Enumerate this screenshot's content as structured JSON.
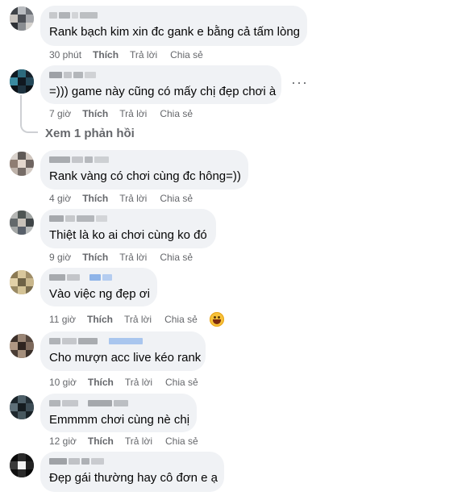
{
  "labels": {
    "like": "Thích",
    "reply": "Trả lời",
    "share": "Chia sẻ"
  },
  "comments": [
    {
      "text": "Rank bạch kim xin đc gank e bằng cả tấm lòng",
      "time": "30 phút"
    },
    {
      "text": "=))) game này cũng có mấy chị đẹp chơi à",
      "time": "7 giờ",
      "view_replies": "Xem 1 phản hồi"
    },
    {
      "text": "Rank vàng có chơi cùng đc hông=))",
      "time": "4 giờ"
    },
    {
      "text": "Thiệt là ko ai chơi cùng ko đó",
      "time": "9 giờ"
    },
    {
      "text": "Vào việc ng đẹp ơi",
      "time": "11 giờ",
      "reaction": "grinning-sweat-emoji"
    },
    {
      "text": "Cho mượn acc live kéo rank",
      "time": "10 giờ"
    },
    {
      "text": "Emmmm chơi cùng nè chị",
      "time": "12 giờ"
    },
    {
      "text": "Đẹp gái thường hay cô đơn e ạ",
      "time": ""
    }
  ],
  "icons": {
    "more": "more-options-icon"
  },
  "colors": {
    "bubble": "#f0f2f5",
    "meta_text": "#65676b",
    "thread_line": "#ced0d4"
  }
}
